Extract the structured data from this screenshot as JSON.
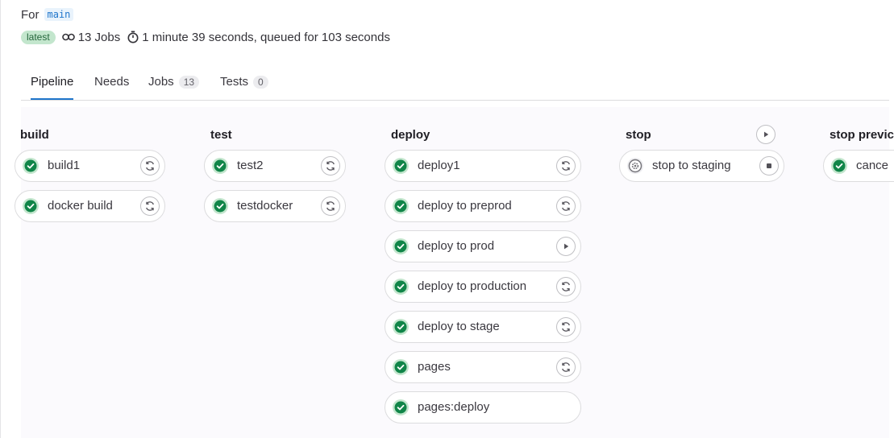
{
  "header": {
    "for_label": "For",
    "branch": "main",
    "latest_badge": "latest",
    "jobs_summary": "13 Jobs",
    "duration": "1 minute 39 seconds, queued for 103 seconds"
  },
  "tabs": [
    {
      "label": "Pipeline",
      "active": true
    },
    {
      "label": "Needs"
    },
    {
      "label": "Jobs",
      "count": "13"
    },
    {
      "label": "Tests",
      "count": "0"
    }
  ],
  "stages": [
    {
      "name": "build",
      "jobs": [
        {
          "name": "build1",
          "status": "passed",
          "action": "retry"
        },
        {
          "name": "docker build",
          "status": "passed",
          "action": "retry"
        }
      ]
    },
    {
      "name": "test",
      "jobs": [
        {
          "name": "test2",
          "status": "passed",
          "action": "retry"
        },
        {
          "name": "testdocker",
          "status": "passed",
          "action": "retry"
        }
      ]
    },
    {
      "name": "deploy",
      "jobs": [
        {
          "name": "deploy1",
          "status": "passed",
          "action": "retry"
        },
        {
          "name": "deploy to preprod",
          "status": "passed",
          "action": "retry"
        },
        {
          "name": "deploy to prod",
          "status": "passed",
          "action": "play"
        },
        {
          "name": "deploy to production",
          "status": "passed",
          "action": "retry"
        },
        {
          "name": "deploy to stage",
          "status": "passed",
          "action": "retry"
        },
        {
          "name": "pages",
          "status": "passed",
          "action": "retry"
        },
        {
          "name": "pages:deploy",
          "status": "passed"
        }
      ]
    },
    {
      "name": "stop",
      "stage_action": "play",
      "jobs": [
        {
          "name": "stop to staging",
          "status": "manual",
          "action": "stop"
        }
      ]
    },
    {
      "name": "stop previc",
      "jobs": [
        {
          "name": "cance",
          "status": "passed"
        }
      ]
    }
  ],
  "colors": {
    "accent": "#1f75cb",
    "success": "#108548",
    "success_bg": "#c3e6cd"
  }
}
